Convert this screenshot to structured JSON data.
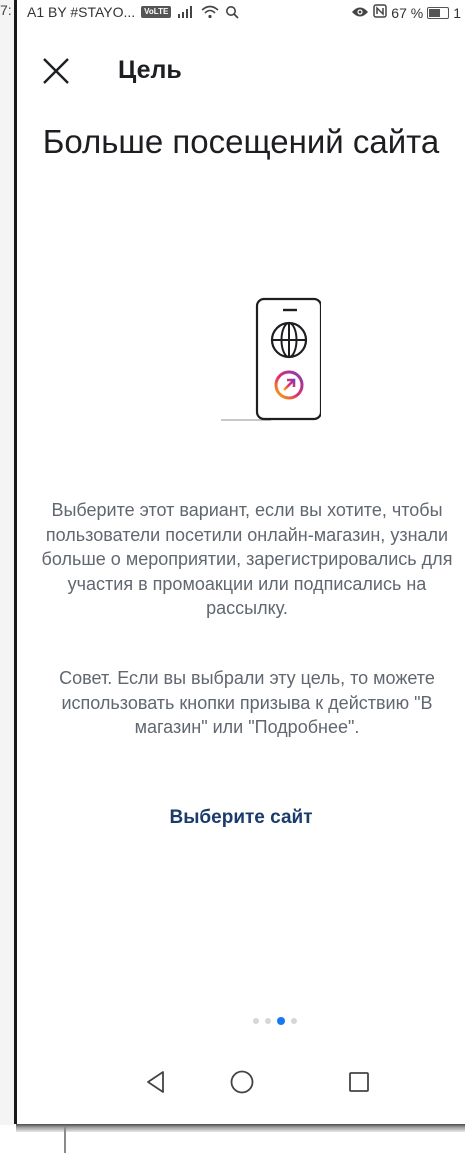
{
  "status_bar": {
    "clock_fragment": "7:",
    "carrier": "A1 BY #STAYO...",
    "volte_label": "VoLTE",
    "battery_text": "67 %",
    "battery_level": 0.67,
    "trailing_text": "1"
  },
  "header": {
    "title": "Цель"
  },
  "main": {
    "title": "Больше посещений сайта",
    "description": "Выберите этот вариант, если вы хотите, чтобы пользователи посетили онлайн-магазин, узнали больше о мероприятии, зарегистрировались для участия в промоакции или подписались на рассылку.",
    "tip": "Совет. Если вы выбрали эту цель, то можете использовать кнопки призыва к действию \"В магазин\" или \"Подробнее\".",
    "action_label": "Выберите сайт"
  },
  "pager": {
    "total": 4,
    "active_index": 2
  },
  "colors": {
    "title_text": "#1c1e21",
    "body_text": "#606770",
    "action_link": "#1b3b6b",
    "pager_active": "#1877f2",
    "pager_inactive": "#d6d6d6"
  },
  "icons": {
    "close": "close-icon",
    "illustration": "phone-globe-icon",
    "nav_back": "back-triangle-icon",
    "nav_home": "home-circle-icon",
    "nav_recents": "recents-square-icon"
  }
}
